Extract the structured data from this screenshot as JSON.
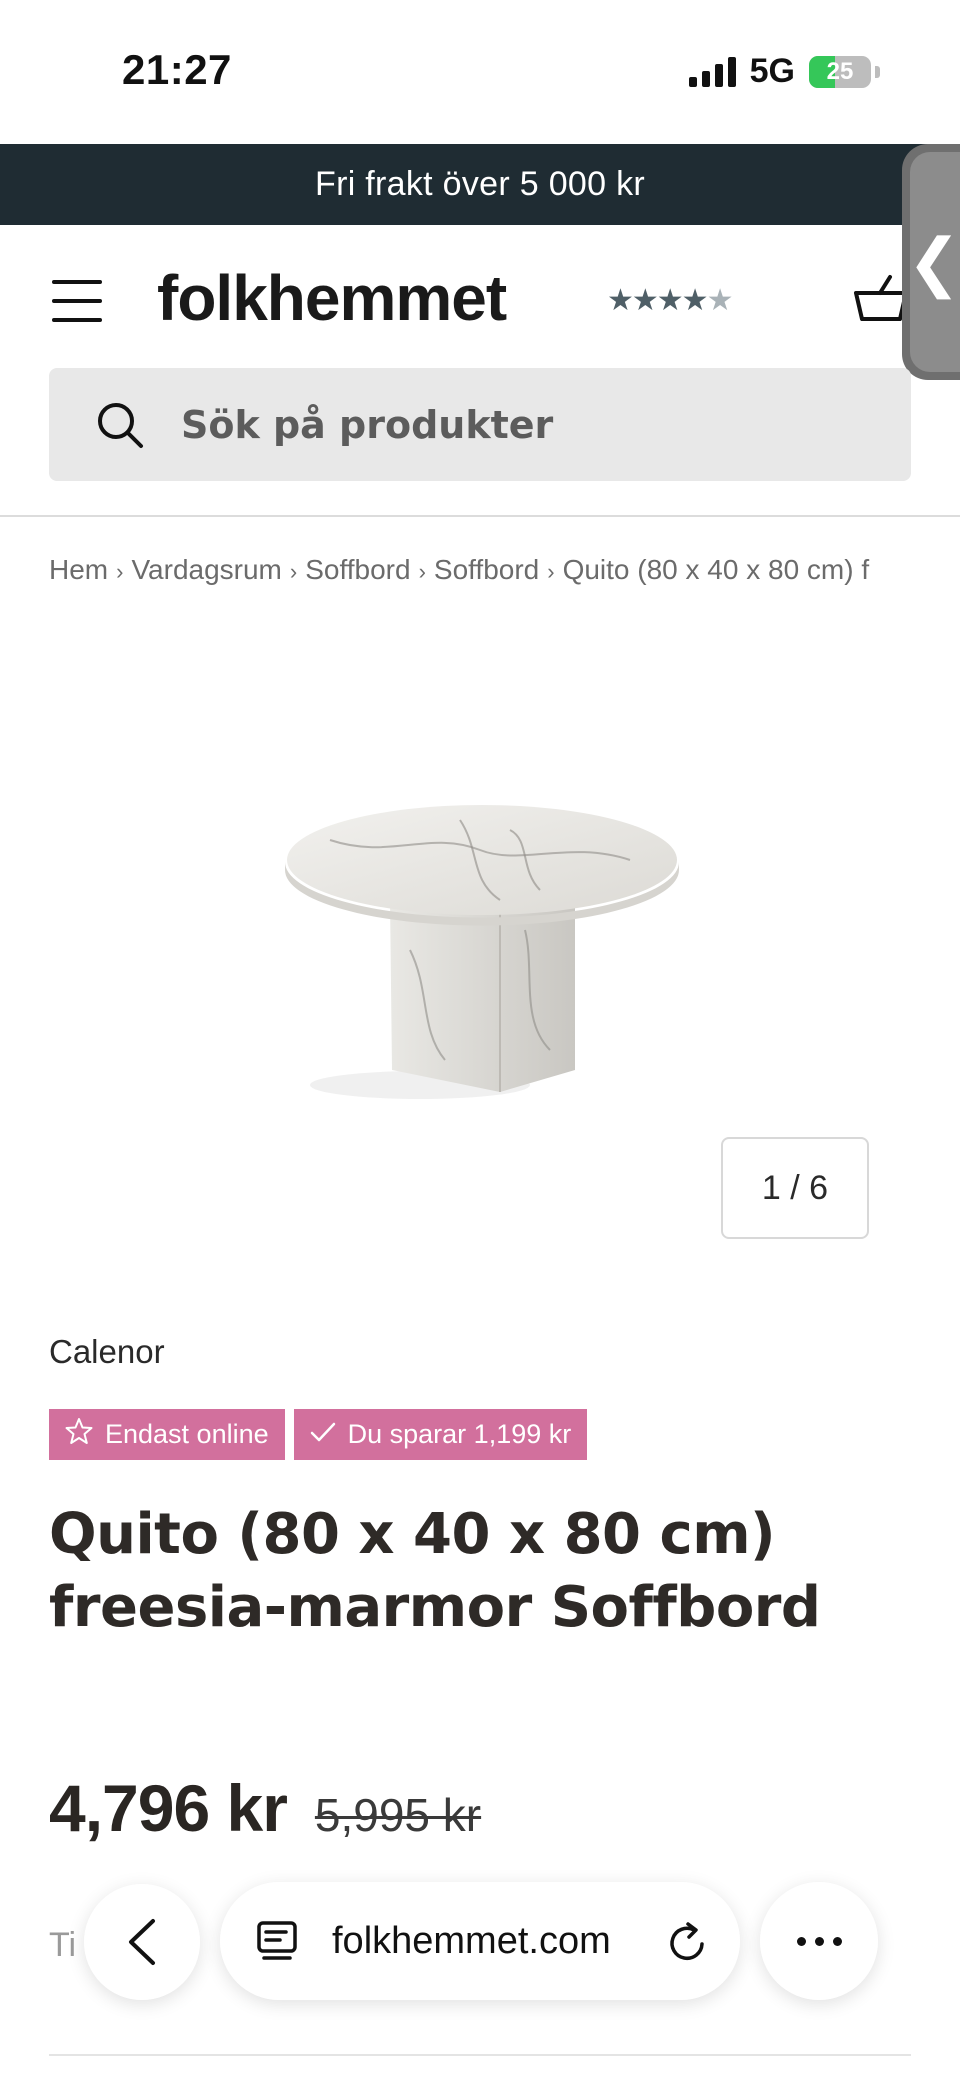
{
  "status_bar": {
    "time": "21:27",
    "network": "5G",
    "battery": "25"
  },
  "promo_banner": {
    "text": "Fri frakt över 5 000 kr"
  },
  "header": {
    "logo": "folkhemmet",
    "rating_stars": 4.5,
    "icons": [
      "menu-icon",
      "cart-icon"
    ]
  },
  "search": {
    "placeholder": "Sök på produkter"
  },
  "breadcrumb": {
    "items": [
      "Hem",
      "Vardagsrum",
      "Soffbord",
      "Soffbord",
      "Quito (80 x 40 x 80 cm) f"
    ]
  },
  "gallery": {
    "counter": "1 / 6"
  },
  "product": {
    "brand": "Calenor",
    "badges": [
      {
        "label": "Endast online",
        "icon": "star-icon"
      },
      {
        "label": "Du sparar 1,199 kr",
        "icon": "check-icon"
      }
    ],
    "title": "Quito (80 x 40 x 80 cm) freesia-marmor Soffbord",
    "price": "4,796 kr",
    "old_price": "5,995 kr",
    "partial_text": "Ti"
  },
  "browser_toolbar": {
    "url": "folkhemmet.com",
    "icons": [
      "back-icon",
      "tabs-icon",
      "reload-icon",
      "more-icon"
    ]
  },
  "colors": {
    "promo_bg": "#1f2c33",
    "badge_bg": "#d2709d",
    "search_bg": "#e8e8e8"
  }
}
